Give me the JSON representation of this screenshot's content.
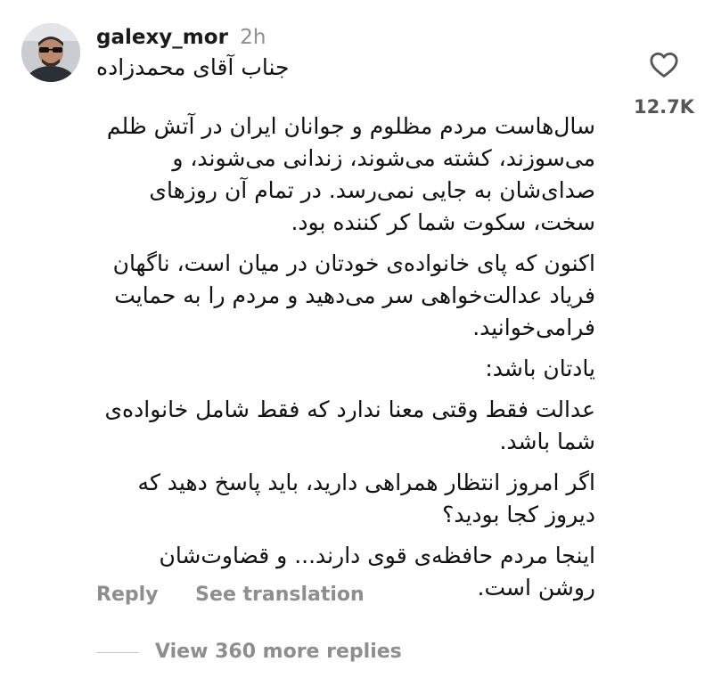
{
  "comment": {
    "username": "galexy_mor",
    "time": "2h",
    "avatar_icon": "user-avatar-photo",
    "paragraphs": [
      "جناب آقای محمدزاده",
      "سال‌هاست مردم مظلوم و جوانان ایران در آتش ظلم می‌سوزند، کشته می‌شوند، زندانی می‌شوند، و صدای‌شان به جایی نمی‌رسد. در تمام آن روزهای سخت، سکوت شما کر کننده بود.",
      "اکنون که پای خانواده‌ی خودتان در میان است، ناگهان فریاد عدالت‌خواهی سر می‌دهید و مردم را به حمایت فرامی‌خوانید.",
      "یادتان باشد:",
      "عدالت فقط وقتی معنا ندارد که فقط شامل خانواده‌ی شما باشد.",
      "اگر امروز انتظار همراهی دارید، باید پاسخ دهید که دیروز کجا بودید؟",
      "اینجا مردم حافظه‌ی قوی دارند... و قضاوت‌شان روشن است."
    ],
    "actions": {
      "reply": "Reply",
      "see_translation": "See translation"
    },
    "likes": {
      "count": "12.7K",
      "icon": "heart-outline-icon"
    },
    "more_replies": "View 360 more replies"
  },
  "colors": {
    "text": "#111111",
    "muted": "#8e8e8e",
    "like_count": "#555555",
    "divider": "#c7c7c7",
    "background": "#ffffff"
  }
}
